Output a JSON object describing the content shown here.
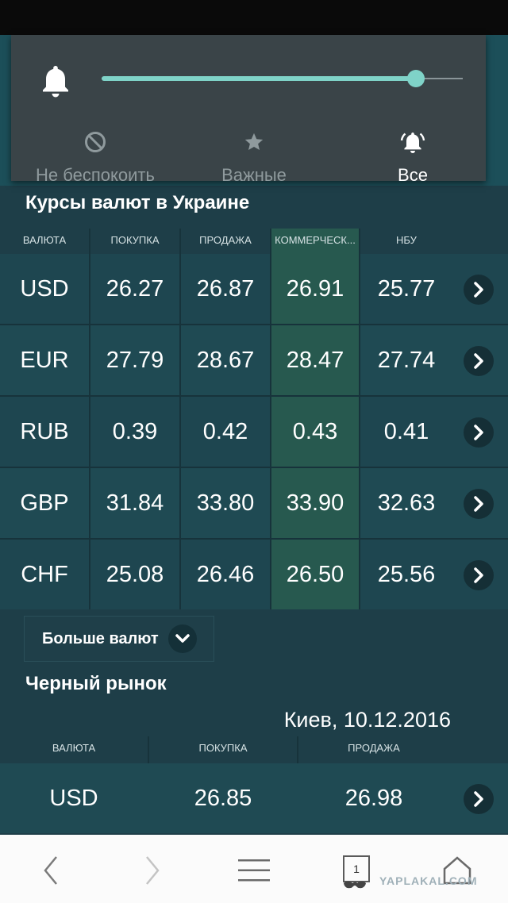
{
  "notifications": {
    "volume_level": 0.87,
    "modes": [
      {
        "label": "Не беспокоить",
        "icon": "do-not-disturb-icon"
      },
      {
        "label": "Важные",
        "icon": "star-icon"
      },
      {
        "label": "Все",
        "icon": "bell-ringing-icon"
      }
    ],
    "active_mode": "Все"
  },
  "rates": {
    "title": "Курсы валют в Украине",
    "headers": [
      "ВАЛЮТА",
      "ПОКУПКА",
      "ПРОДАЖА",
      "КОММЕРЧЕСК...",
      "НБУ"
    ],
    "rows": [
      {
        "currency": "USD",
        "buy": "26.27",
        "sell": "26.87",
        "commercial": "26.91",
        "nbu": "25.77"
      },
      {
        "currency": "EUR",
        "buy": "27.79",
        "sell": "28.67",
        "commercial": "28.47",
        "nbu": "27.74"
      },
      {
        "currency": "RUB",
        "buy": "0.39",
        "sell": "0.42",
        "commercial": "0.43",
        "nbu": "0.41"
      },
      {
        "currency": "GBP",
        "buy": "31.84",
        "sell": "33.80",
        "commercial": "33.90",
        "nbu": "32.63"
      },
      {
        "currency": "CHF",
        "buy": "25.08",
        "sell": "26.46",
        "commercial": "26.50",
        "nbu": "25.56"
      }
    ],
    "more_label": "Больше валют"
  },
  "black_market": {
    "title": "Черный рынок",
    "location_date": "Киев, 10.12.2016",
    "headers": [
      "ВАЛЮТА",
      "ПОКУПКА",
      "ПРОДАЖА"
    ],
    "rows": [
      {
        "currency": "USD",
        "buy": "26.85",
        "sell": "26.98"
      }
    ]
  },
  "browser_nav": {
    "tab_count": "1",
    "watermark": "YAPLAKAL.COM"
  },
  "colors": {
    "accent": "#7fd3c8",
    "panel": "#3a4448",
    "background": "#1e3e48",
    "commercial_column": "#27594f"
  }
}
